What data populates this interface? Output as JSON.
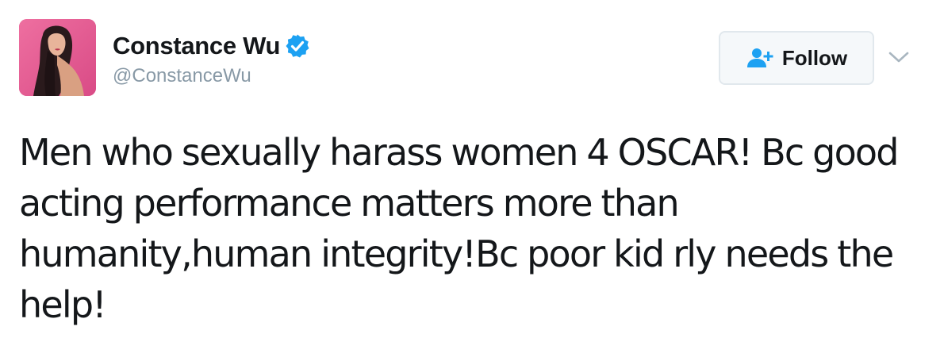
{
  "author": {
    "display_name": "Constance Wu",
    "handle": "@ConstanceWu",
    "verified": true,
    "avatar_icon": "profile-photo"
  },
  "actions": {
    "follow_label": "Follow",
    "follow_icon": "add-user-icon",
    "menu_icon": "chevron-down-icon"
  },
  "tweet": {
    "text": "Men who sexually harass women 4 OSCAR! Bc good acting performance matters more than humanity,human integrity!Bc poor kid rly needs the help!"
  },
  "colors": {
    "text": "#14171a",
    "secondary_text": "#8899a6",
    "verified_badge": "#1da1f2",
    "follow_icon": "#1da1f2",
    "button_border": "#e1e8ed",
    "button_bg": "#f5f8fa",
    "avatar_bg": "#e2568e"
  }
}
